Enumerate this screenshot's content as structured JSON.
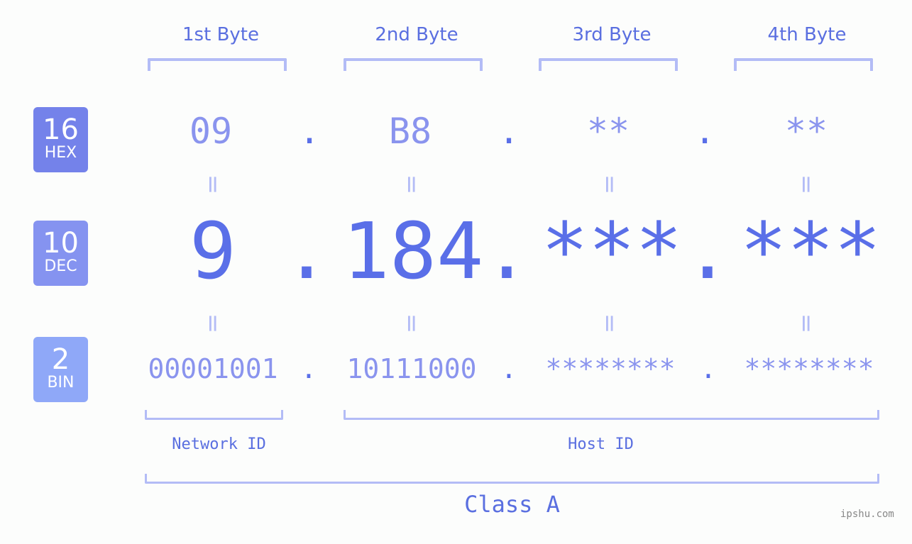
{
  "byte_headers": [
    "1st Byte",
    "2nd Byte",
    "3rd Byte",
    "4th Byte"
  ],
  "badges": [
    {
      "num": "16",
      "label": "HEX",
      "color": "#7482ea"
    },
    {
      "num": "10",
      "label": "DEC",
      "color": "#8593f0"
    },
    {
      "num": "2",
      "label": "BIN",
      "color": "#8fa8f8"
    }
  ],
  "hex": [
    "09",
    "B8",
    "**",
    "**"
  ],
  "dec": [
    "9",
    "184",
    "***",
    "***"
  ],
  "bin": [
    "00001001",
    "10111000",
    "********",
    "********"
  ],
  "separator": ".",
  "equals": "=",
  "network_label": "Network ID",
  "host_label": "Host ID",
  "class_label": "Class A",
  "watermark": "ipshu.com"
}
